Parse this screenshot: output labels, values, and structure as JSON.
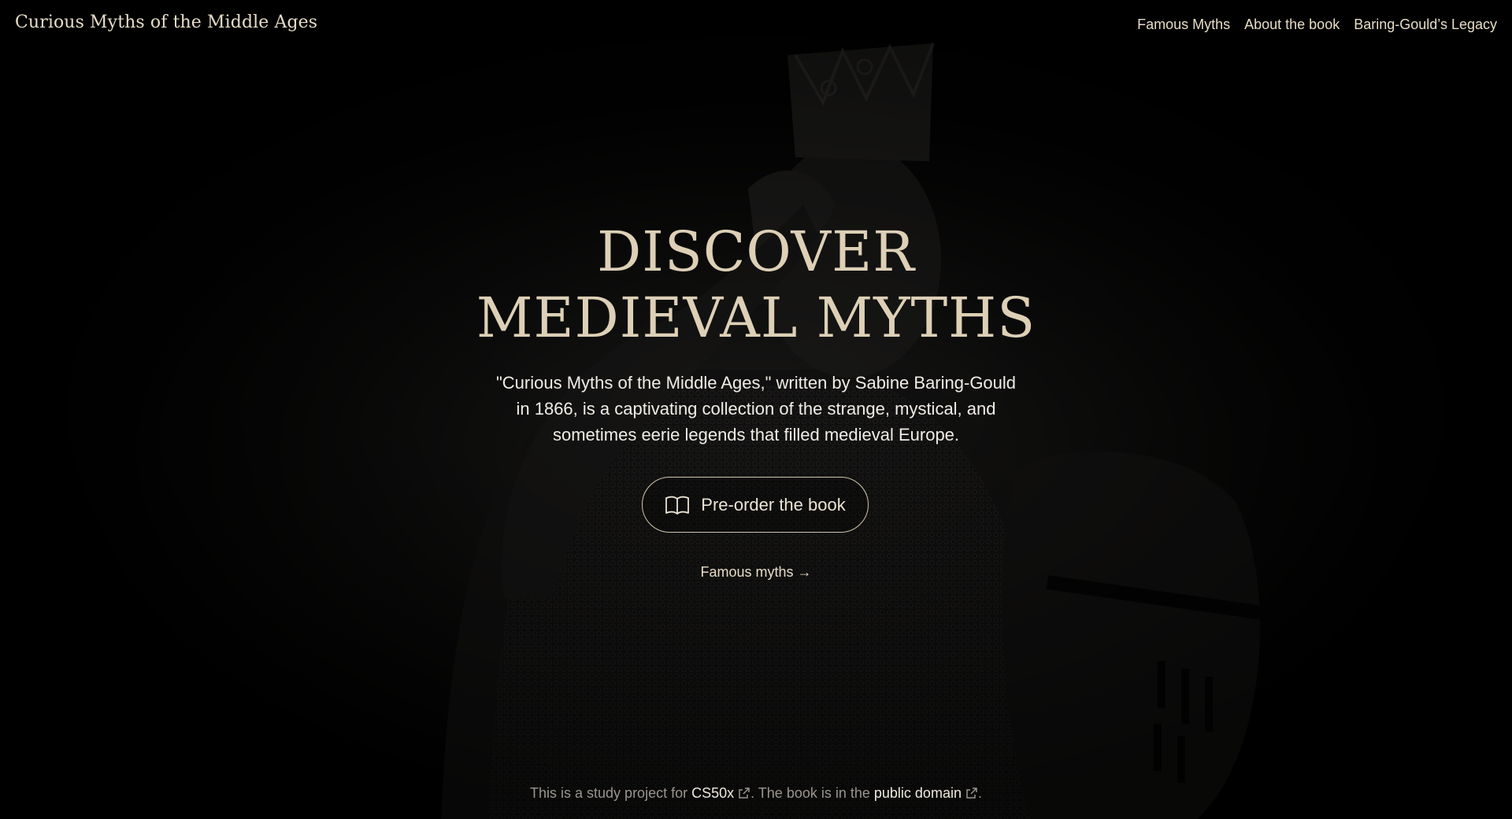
{
  "header": {
    "brand": "Curious Myths of the Middle Ages",
    "nav": [
      {
        "label": "Famous Myths"
      },
      {
        "label": "About the book"
      },
      {
        "label": "Baring-Gould’s Legacy"
      }
    ]
  },
  "hero": {
    "title_line1": "DISCOVER",
    "title_line2": "MEDIEVAL MYTHS",
    "description": "\"Curious Myths of the Middle Ages,\" written by Sabine Baring-Gould in 1866, is a captivating collection of the strange, mystical, and sometimes eerie legends that filled medieval Europe.",
    "cta_label": "Pre-order the book",
    "cta_icon": "open-book-icon",
    "secondary_link": "Famous myths →"
  },
  "footer": {
    "text_before": "This is a study project for ",
    "link1": "CS50x",
    "text_middle": ". The book is in the ",
    "link2": "public domain",
    "text_after": ".",
    "link_icon": "external-link-icon"
  },
  "colors": {
    "background": "#000000",
    "accent": "#ddd0b6",
    "text": "#f1ede6",
    "muted": "#9a958d"
  }
}
